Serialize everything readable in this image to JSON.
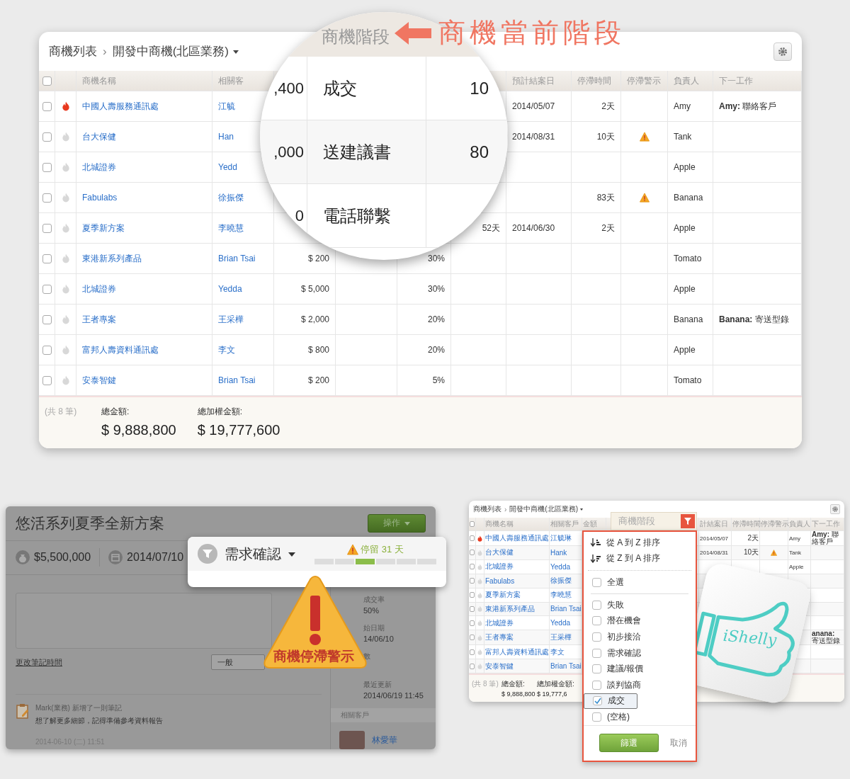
{
  "top_panel": {
    "breadcrumb": {
      "root": "商機列表",
      "separator": "›",
      "current": "開發中商機(北區業務)"
    },
    "select_all_checked": false,
    "headers": {
      "name": "商機名稱",
      "customer": "相關客",
      "close_date": "預計結案日",
      "stall_time": "停滯時間",
      "stall_alert": "停滯警示",
      "owner": "負責人",
      "next_task": "下一工作"
    },
    "rows": [
      {
        "checked": false,
        "hot": true,
        "name": "中國人壽服務通訊處",
        "customer": "江毓",
        "close_date": "2014/05/07",
        "stall_time": "2天",
        "stall_alert": false,
        "owner": "Amy",
        "next_task": "**Amy:** 聯絡客戶"
      },
      {
        "checked": false,
        "hot": false,
        "name": "台大保健",
        "customer": "Han",
        "close_date": "2014/08/31",
        "stall_time": "10天",
        "stall_alert": true,
        "owner": "Tank"
      },
      {
        "checked": false,
        "hot": false,
        "name": "北城證券",
        "customer": "Yedd",
        "stall_alert": false,
        "owner": "Apple"
      },
      {
        "checked": false,
        "hot": false,
        "name": "Fabulabs",
        "customer": "徐振傑",
        "stall_time": "83天",
        "stall_alert": true,
        "owner": "Banana"
      },
      {
        "checked": false,
        "hot": false,
        "name": "夏季新方案",
        "customer": "李曉慧",
        "column_7": "52天",
        "close_date": "2014/06/30",
        "stall_time": "2天",
        "stall_alert": false,
        "owner": "Apple"
      },
      {
        "checked": false,
        "hot": false,
        "name": "東港新系列產品",
        "customer": "Brian Tsai",
        "amount": "$ 200",
        "probability": "30%",
        "stall_alert": false,
        "owner": "Tomato"
      },
      {
        "checked": false,
        "hot": false,
        "name": "北城證券",
        "customer": "Yedda",
        "amount": "$ 5,000",
        "probability": "30%",
        "stall_alert": false,
        "owner": "Apple"
      },
      {
        "checked": false,
        "hot": false,
        "name": "王者專案",
        "customer": "王采樺",
        "amount": "$ 2,000",
        "probability": "20%",
        "stall_alert": false,
        "owner": "Banana",
        "next_task": "**Banana:** 寄送型錄"
      },
      {
        "checked": false,
        "hot": false,
        "name": "富邦人壽資料通訊處",
        "customer": "李文",
        "amount": "$ 800",
        "probability": "20%",
        "stall_alert": false,
        "owner": "Apple"
      },
      {
        "checked": false,
        "hot": false,
        "name": "安泰智鍵",
        "customer": "Brian Tsai",
        "amount": "$ 200",
        "probability": "5%",
        "stall_alert": false,
        "owner": "Tomato"
      }
    ],
    "footer": {
      "count": "(共 8 筆)",
      "total_label": "總金額:",
      "total": "$ 9,888,800",
      "weighted_label": "總加權金額:",
      "weighted_total": "$ 19,777,600"
    },
    "magnifier": {
      "header": "商機階段",
      "rows": [
        {
          "amount": ",400",
          "stage": "成交",
          "probability": "10"
        },
        {
          "amount": ",000",
          "stage": "送建議書",
          "probability": "80"
        },
        {
          "amount": "0",
          "stage": "電話聯繫"
        }
      ]
    },
    "annotation": "商機當前階段"
  },
  "detail_panel": {
    "title": "悠活系列夏季全新方案",
    "action_button": "操作",
    "amount": "$5,500,000",
    "date": "2014/07/10",
    "change_time_link": "更改筆記時間",
    "note_type": "一般",
    "sidebar": [
      {
        "label": "成交率",
        "value": "50%"
      },
      {
        "label": "始日期",
        "value": "14/06/10"
      },
      {
        "label": "數"
      },
      {
        "label": "最近更新",
        "value": "2014/06/19 11:45"
      }
    ],
    "related_header": "相關客戶",
    "contact": "林愛華",
    "note": {
      "author": "Mark(業務)",
      "action": "新增了一則筆記",
      "text": "想了解更多細節，記得準備參考資料報告",
      "time": "2014-06-10 (二) 11:51"
    },
    "stage_popup": {
      "stage": "需求確認",
      "stay": "停留 31 天",
      "segments": [
        {
          "selected": false
        },
        {
          "selected": false
        },
        {
          "selected": true
        },
        {
          "selected": false
        },
        {
          "selected": false
        },
        {
          "selected": false
        }
      ]
    },
    "warning": "商機停滯警示"
  },
  "mini_panel": {
    "breadcrumb": {
      "root": "商機列表",
      "separator": "›",
      "current": "開發中商機(北區業務)"
    },
    "select_all_checked": false,
    "headers": {
      "name": "商機名稱",
      "customer": "相關客戶",
      "amount": "金額",
      "close_date": "計結案日",
      "stall_time": "停滯時間",
      "stall_alert": "停滯警示",
      "owner": "負責人",
      "next_task": "下一工作"
    },
    "rows": [
      {
        "checked": false,
        "hot": true,
        "name": "中國人壽服務通訊處",
        "customer": "江毓琳",
        "close_date": "2014/05/07",
        "stall_time": "2天",
        "stall_alert": false,
        "owner": "Amy",
        "next_task": "**Amy:** 聯絡客戶"
      },
      {
        "checked": false,
        "hot": false,
        "name": "台大保健",
        "customer": "Hank",
        "close_date": "2014/08/31",
        "stall_time": "10天",
        "stall_alert": true,
        "owner": "Tank"
      },
      {
        "checked": false,
        "hot": false,
        "name": "北城證券",
        "customer": "Yedda",
        "stall_alert": false,
        "owner": "Apple"
      },
      {
        "checked": false,
        "hot": false,
        "name": "Fabulabs",
        "customer": "徐振傑"
      },
      {
        "checked": false,
        "hot": false,
        "name": "夏季新方案",
        "customer": "李曉慧"
      },
      {
        "checked": false,
        "hot": false,
        "name": "東港新系列產品",
        "customer": "Brian Tsai"
      },
      {
        "checked": false,
        "hot": false,
        "name": "北城證券",
        "customer": "Yedda"
      },
      {
        "checked": false,
        "hot": false,
        "name": "王者專案",
        "customer": "王采樺",
        "next_task": "**anana:** 寄送型錄"
      },
      {
        "checked": false,
        "hot": false,
        "name": "富邦人壽資料通訊處",
        "customer": "李文"
      },
      {
        "checked": false,
        "hot": false,
        "name": "安泰智鍵",
        "customer": "Brian Tsai"
      }
    ],
    "footer": {
      "count": "(共 8 筆)",
      "total_label": "總金額:",
      "total": "$ 9,888,800",
      "weighted_label": "總加權金額:",
      "weighted_total": "$ 19,777,6"
    },
    "filter_menu": {
      "header": "商機階段",
      "sort_options": [
        "從 A 到 Z 排序",
        "從 Z 到 A 排序"
      ],
      "select_all": {
        "label": "全選",
        "checked": false
      },
      "options": [
        {
          "label": "失敗",
          "checked": false
        },
        {
          "label": "潛在機會",
          "checked": false
        },
        {
          "label": "初步接洽",
          "checked": false
        },
        {
          "label": "需求確認",
          "checked": false
        },
        {
          "label": "建議/報價",
          "checked": false
        },
        {
          "label": "談判協商",
          "checked": false
        },
        {
          "label": "成交",
          "checked": true
        },
        {
          "label": "(空格)",
          "checked": false
        }
      ],
      "filter_button": "篩選",
      "cancel_button": "取消"
    },
    "logo_text": "iShelly"
  }
}
